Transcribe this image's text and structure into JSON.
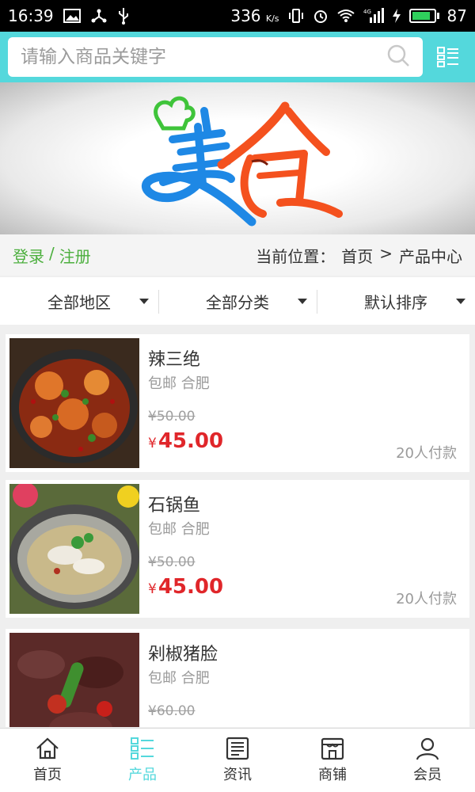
{
  "status_bar": {
    "time": "16:39",
    "net_speed": "336",
    "net_unit": "K/s",
    "network": "4G",
    "battery": "87",
    "battery_level": 0.87
  },
  "search": {
    "placeholder": "请输入商品关键字"
  },
  "banner": {
    "logo_text": "美食"
  },
  "auth": {
    "login": "登录",
    "separator": "/",
    "register": "注册"
  },
  "breadcrumb": {
    "prefix": "当前位置：",
    "home": "首页",
    "sep": ">",
    "current": "产品中心"
  },
  "filters": [
    {
      "label": "全部地区"
    },
    {
      "label": "全部分类"
    },
    {
      "label": "默认排序"
    }
  ],
  "products": [
    {
      "name": "辣三绝",
      "tag": "包邮 合肥",
      "old_price": "¥50.00",
      "currency": "¥",
      "price": "45.00",
      "sold": "20人付款"
    },
    {
      "name": "石锅鱼",
      "tag": "包邮 合肥",
      "old_price": "¥50.00",
      "currency": "¥",
      "price": "45.00",
      "sold": "20人付款"
    },
    {
      "name": "剁椒猪脸",
      "tag": "包邮 合肥",
      "old_price": "¥60.00",
      "currency": "¥",
      "price": "",
      "sold": ""
    }
  ],
  "tabs": [
    {
      "label": "首页",
      "icon": "home-icon"
    },
    {
      "label": "产品",
      "icon": "list-icon",
      "active": true
    },
    {
      "label": "资讯",
      "icon": "news-icon"
    },
    {
      "label": "商铺",
      "icon": "shop-icon"
    },
    {
      "label": "会员",
      "icon": "member-icon"
    }
  ],
  "colors": {
    "accent": "#54d8dc",
    "price": "#e0262a",
    "login": "#4caf3e"
  }
}
